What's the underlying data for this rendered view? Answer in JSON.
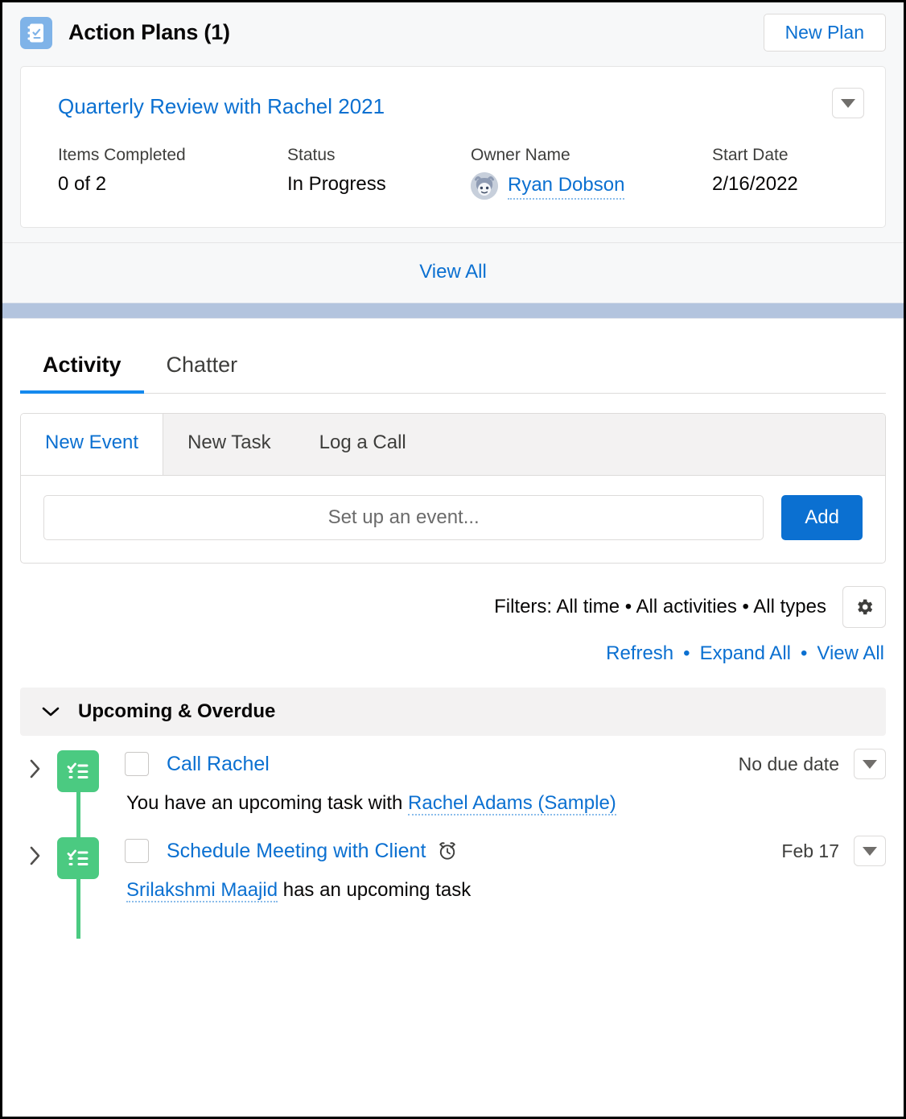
{
  "action_plans": {
    "icon": "action-plan-icon",
    "title": "Action Plans (1)",
    "new_plan_label": "New Plan",
    "card": {
      "title": "Quarterly Review with Rachel 2021",
      "menu_icon": "chevron-down-icon",
      "fields": [
        {
          "label": "Items Completed",
          "value": "0 of 2"
        },
        {
          "label": "Status",
          "value": "In Progress"
        },
        {
          "label": "Owner Name",
          "value": "Ryan Dobson",
          "is_link": true,
          "avatar": "user-avatar"
        },
        {
          "label": "Start Date",
          "value": "2/16/2022"
        }
      ]
    },
    "view_all_label": "View All"
  },
  "activity": {
    "tabs": [
      {
        "label": "Activity",
        "active": true
      },
      {
        "label": "Chatter",
        "active": false
      }
    ],
    "composer": {
      "subtabs": [
        {
          "label": "New Event",
          "active": true
        },
        {
          "label": "New Task",
          "active": false
        },
        {
          "label": "Log a Call",
          "active": false
        }
      ],
      "input_value": "",
      "input_placeholder": "Set up an event...",
      "add_label": "Add"
    },
    "filters": {
      "text": "Filters: All time • All activities • All types",
      "gear_icon": "gear-icon"
    },
    "links": [
      {
        "label": "Refresh"
      },
      {
        "label": "Expand All"
      },
      {
        "label": "View All"
      }
    ],
    "link_separator": "•",
    "section": {
      "collapse_icon": "chevron-down-icon",
      "label": "Upcoming & Overdue"
    },
    "items": [
      {
        "expand_icon": "chevron-right-icon",
        "type_icon": "task-icon",
        "checkbox_checked": false,
        "title": "Call Rachel",
        "has_reminder": false,
        "date": "No due date",
        "menu_icon": "chevron-down-icon",
        "subtitle_prefix": "You have an upcoming task with ",
        "subtitle_link": "Rachel Adams (Sample)",
        "subtitle_suffix": ""
      },
      {
        "expand_icon": "chevron-right-icon",
        "type_icon": "task-icon",
        "checkbox_checked": false,
        "title": "Schedule Meeting with Client",
        "has_reminder": true,
        "reminder_icon": "alarm-clock-icon",
        "date": "Feb 17",
        "menu_icon": "chevron-down-icon",
        "subtitle_prefix": "",
        "subtitle_link": "Srilakshmi Maajid",
        "subtitle_suffix": " has an upcoming task"
      }
    ]
  },
  "colors": {
    "link_blue": "#0b70d1",
    "primary_blue": "#0b70d1",
    "task_green": "#4bca81",
    "header_icon_blue": "#7fb3e8",
    "band_blue": "#b3c4de"
  }
}
